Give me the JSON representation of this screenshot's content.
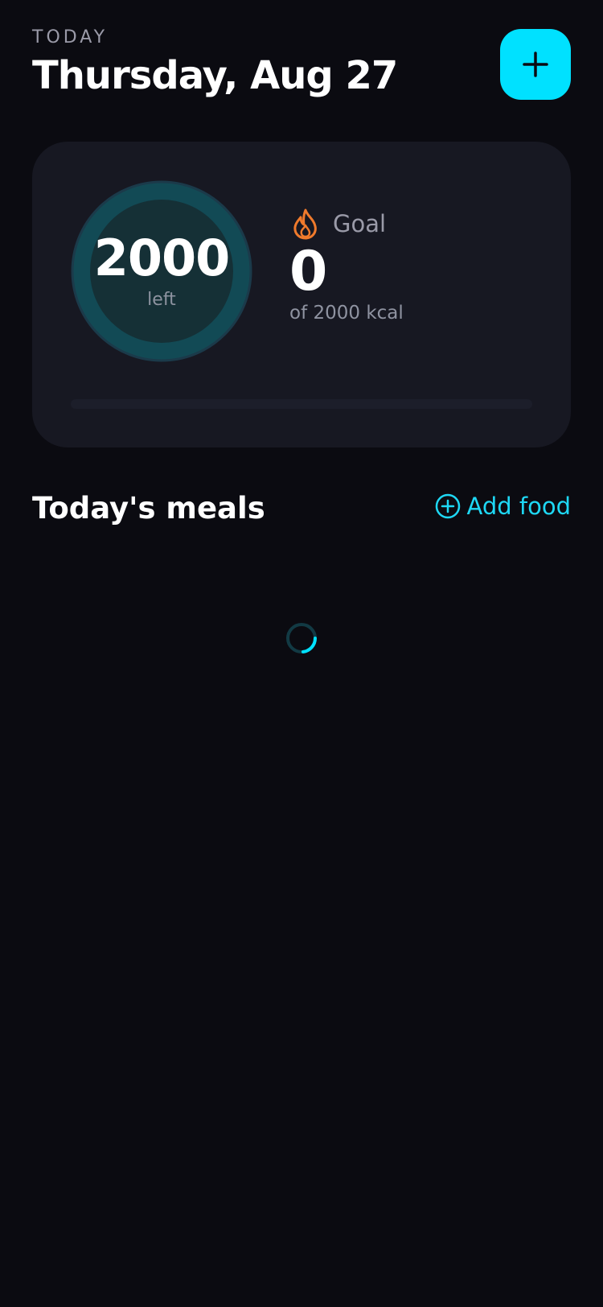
{
  "header": {
    "overline": "TODAY",
    "date_title": "Thursday, Aug 27",
    "add_button_icon": "plus-icon"
  },
  "summary": {
    "remaining_value": "2000",
    "remaining_label": "left",
    "goal_icon": "flame-icon",
    "goal_label": "Goal",
    "consumed_value": "0",
    "goal_subtext": "of 2000 kcal",
    "progress_fraction": 0
  },
  "meals": {
    "title": "Today's meals",
    "add_food_label": "Add food",
    "add_food_icon": "plus-circle-icon",
    "loading_icon": "loading-spinner-icon"
  },
  "colors": {
    "background": "#0b0b11",
    "card": "#171822",
    "accent": "#00e1ff",
    "flame": "#f07a2c",
    "ring_fill": "#124a55",
    "ring_inner": "#153036"
  }
}
